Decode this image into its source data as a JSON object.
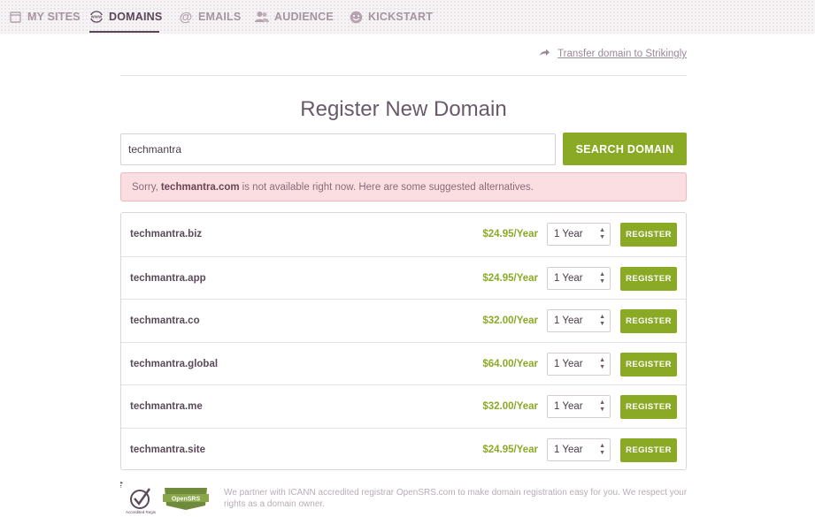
{
  "nav": {
    "items": [
      {
        "label": "MY SITES",
        "icon": "browser-window-icon",
        "active": false
      },
      {
        "label": "DOMAINS",
        "icon": "www-globe-icon",
        "active": true
      },
      {
        "label": "EMAILS",
        "icon": "at-sign-icon",
        "active": false
      },
      {
        "label": "AUDIENCE",
        "icon": "people-icon",
        "active": false
      },
      {
        "label": "KICKSTART",
        "icon": "smiley-icon",
        "active": false
      }
    ]
  },
  "transfer": {
    "label": "Transfer domain to Strikingly",
    "icon": "share-arrow-icon"
  },
  "page_title": "Register New Domain",
  "search": {
    "value": "techmantra",
    "button_label": "SEARCH DOMAIN"
  },
  "alert": {
    "prefix": "Sorry,",
    "domain": "techmantra.com",
    "suffix": "is not available right now. Here are some suggested alternatives."
  },
  "results": [
    {
      "domain": "techmantra.biz",
      "price": "$24.95/Year",
      "term": "1 Year",
      "button": "REGISTER"
    },
    {
      "domain": "techmantra.app",
      "price": "$24.95/Year",
      "term": "1 Year",
      "button": "REGISTER"
    },
    {
      "domain": "techmantra.co",
      "price": "$32.00/Year",
      "term": "1 Year",
      "button": "REGISTER"
    },
    {
      "domain": "techmantra.global",
      "price": "$64.00/Year",
      "term": "1 Year",
      "button": "REGISTER"
    },
    {
      "domain": "techmantra.me",
      "price": "$32.00/Year",
      "term": "1 Year",
      "button": "REGISTER"
    },
    {
      "domain": "techmantra.site",
      "price": "$24.95/Year",
      "term": "1 Year",
      "button": "REGISTER"
    }
  ],
  "footer": {
    "text": "We partner with ICANN accredited registrar OpenSRS.com to make domain registration easy for you. We respect your rights as a domain owner.",
    "icann_logo_text": "ICANN Accredited Registrar",
    "opensrs_logo_text": "OpenSRS"
  },
  "colors": {
    "accent_green": "#8aaa25",
    "nav_active": "#5a4759",
    "alert_bg": "#fbdee2"
  }
}
